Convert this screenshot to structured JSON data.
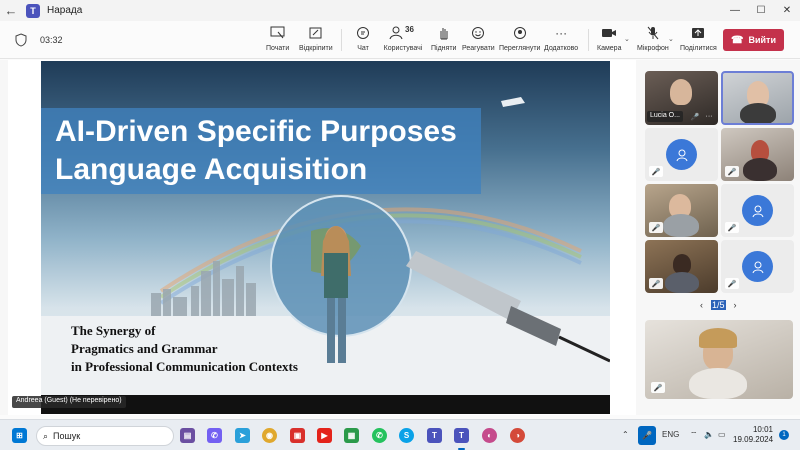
{
  "window": {
    "title": "Нарада",
    "back_icon": "back-arrow-icon",
    "controls": [
      "minimize-icon",
      "maximize-icon",
      "close-icon"
    ]
  },
  "toolbar": {
    "timer": "03:32",
    "participants_count": "36",
    "buttons": [
      {
        "label": "Почати",
        "icon": "start-icon"
      },
      {
        "label": "Відкріпити",
        "icon": "unpin-icon"
      },
      {
        "label": "Чат",
        "icon": "chat-icon"
      },
      {
        "label": "Користувачі",
        "icon": "people-icon"
      },
      {
        "label": "Підняти",
        "icon": "raise-hand-icon"
      },
      {
        "label": "Реагувати",
        "icon": "react-icon"
      },
      {
        "label": "Переглянути",
        "icon": "view-icon"
      },
      {
        "label": "Додатково",
        "icon": "more-icon"
      },
      {
        "label": "Камера",
        "icon": "camera-icon"
      },
      {
        "label": "Мікрофон",
        "icon": "microphone-icon"
      },
      {
        "label": "Поділитися",
        "icon": "share-icon"
      }
    ],
    "leave_label": "Вийти",
    "accent": "#c4314b"
  },
  "slide": {
    "title_line1": "AI-Driven Specific Purposes",
    "title_line2": "Language Acquisition",
    "subtitle_line1": "The Synergy of",
    "subtitle_line2": "Pragmatics and Grammar",
    "subtitle_line3": "in Professional Communication Contexts",
    "presenter_tag": "Andreea (Guest) (Не перевірено)"
  },
  "participants": {
    "first_name": "Lucia O...",
    "pager_current": "1/5",
    "avatar_color": "#3b78d8"
  },
  "taskbar": {
    "search_placeholder": "Пошук",
    "language": "ENG",
    "time": "10:01",
    "date": "19.09.2024"
  }
}
